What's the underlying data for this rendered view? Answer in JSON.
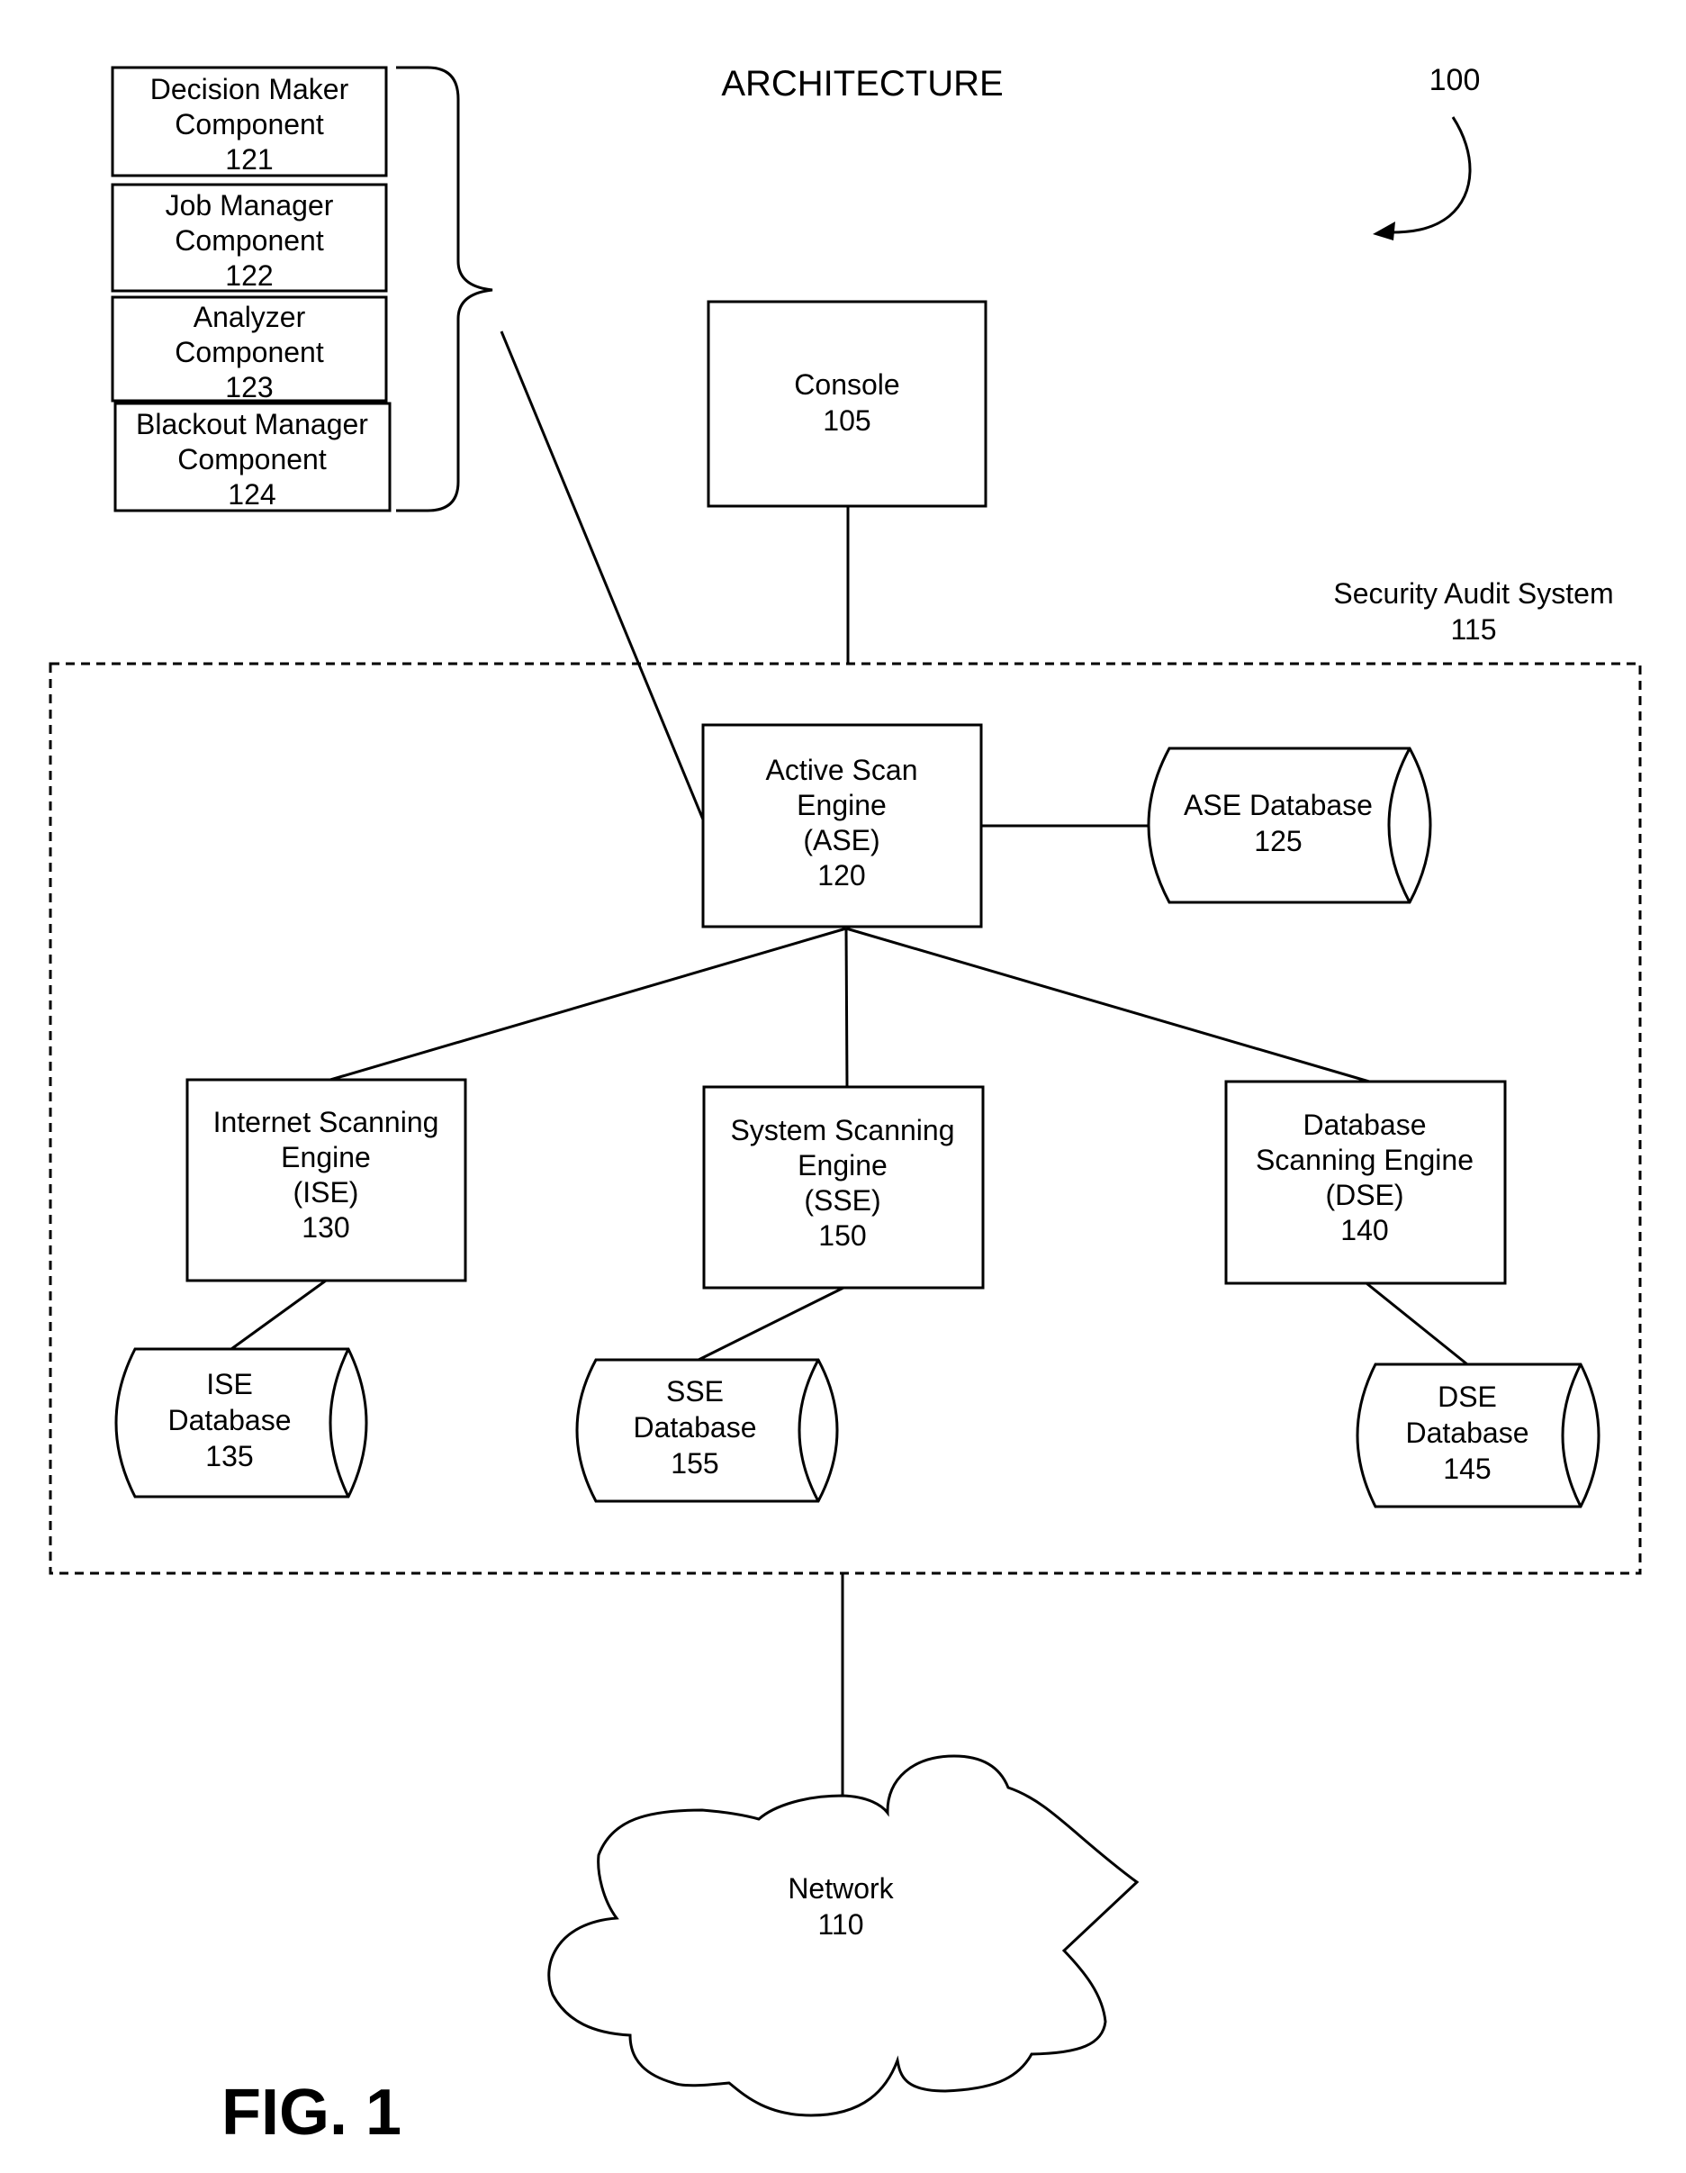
{
  "diagram": {
    "title": "ARCHITECTURE",
    "figure_label": "FIG. 1",
    "reference_numeral": "100",
    "system_boundary": {
      "label": "Security Audit System",
      "number": "115"
    },
    "components_group": [
      {
        "id": "decision-maker",
        "lines": [
          "Decision Maker",
          "Component"
        ],
        "number": "121"
      },
      {
        "id": "job-manager",
        "lines": [
          "Job Manager",
          "Component"
        ],
        "number": "122"
      },
      {
        "id": "analyzer",
        "lines": [
          "Analyzer",
          "Component"
        ],
        "number": "123"
      },
      {
        "id": "blackout-manager",
        "lines": [
          "Blackout Manager",
          "Component"
        ],
        "number": "124"
      }
    ],
    "nodes": {
      "console": {
        "lines": [
          "Console"
        ],
        "number": "105",
        "shape": "box"
      },
      "ase": {
        "lines": [
          "Active Scan",
          "Engine",
          "(ASE)"
        ],
        "number": "120",
        "shape": "box"
      },
      "ase_db": {
        "lines": [
          "ASE Database"
        ],
        "number": "125",
        "shape": "cylinder"
      },
      "ise": {
        "lines": [
          "Internet Scanning",
          "Engine",
          "(ISE)"
        ],
        "number": "130",
        "shape": "box"
      },
      "ise_db": {
        "lines": [
          "ISE",
          "Database"
        ],
        "number": "135",
        "shape": "cylinder"
      },
      "sse": {
        "lines": [
          "System Scanning",
          "Engine",
          "(SSE)"
        ],
        "number": "150",
        "shape": "box"
      },
      "sse_db": {
        "lines": [
          "SSE",
          "Database"
        ],
        "number": "155",
        "shape": "cylinder"
      },
      "dse": {
        "lines": [
          "Database",
          "Scanning Engine",
          "(DSE)"
        ],
        "number": "140",
        "shape": "box"
      },
      "dse_db": {
        "lines": [
          "DSE",
          "Database"
        ],
        "number": "145",
        "shape": "cylinder"
      },
      "network": {
        "lines": [
          "Network"
        ],
        "number": "110",
        "shape": "cloud"
      }
    },
    "edges": [
      [
        "components_group",
        "ase"
      ],
      [
        "console",
        "ase"
      ],
      [
        "ase",
        "ase_db"
      ],
      [
        "ase",
        "ise"
      ],
      [
        "ase",
        "sse"
      ],
      [
        "ase",
        "dse"
      ],
      [
        "ise",
        "ise_db"
      ],
      [
        "sse",
        "sse_db"
      ],
      [
        "dse",
        "dse_db"
      ],
      [
        "system_boundary",
        "network"
      ]
    ]
  }
}
